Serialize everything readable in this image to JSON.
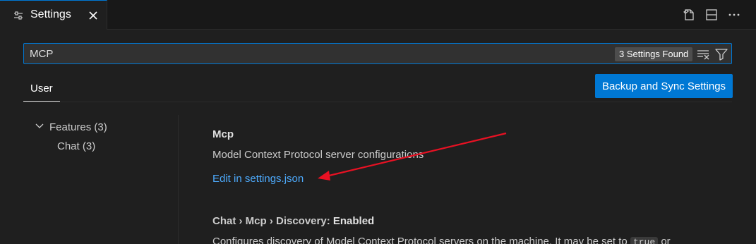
{
  "tab": {
    "title": "Settings"
  },
  "search": {
    "value": "MCP",
    "results_badge": "3 Settings Found"
  },
  "scope": {
    "active_tab": "User"
  },
  "sync_button": {
    "label": "Backup and Sync Settings"
  },
  "toc": {
    "items": [
      {
        "label": "Features (3)"
      },
      {
        "label": "Chat (3)"
      }
    ]
  },
  "settings": [
    {
      "title": "Mcp",
      "description": "Model Context Protocol server configurations",
      "link": "Edit in settings.json"
    },
    {
      "category": "Chat › Mcp › Discovery: ",
      "name": "Enabled",
      "description_prefix": "Configures discovery of Model Context Protocol servers on the machine. It may be set to ",
      "code": "true",
      "description_suffix": " or"
    }
  ],
  "colors": {
    "accent": "#0078d4",
    "link": "#4daafc",
    "annotation_arrow": "#e81123"
  }
}
